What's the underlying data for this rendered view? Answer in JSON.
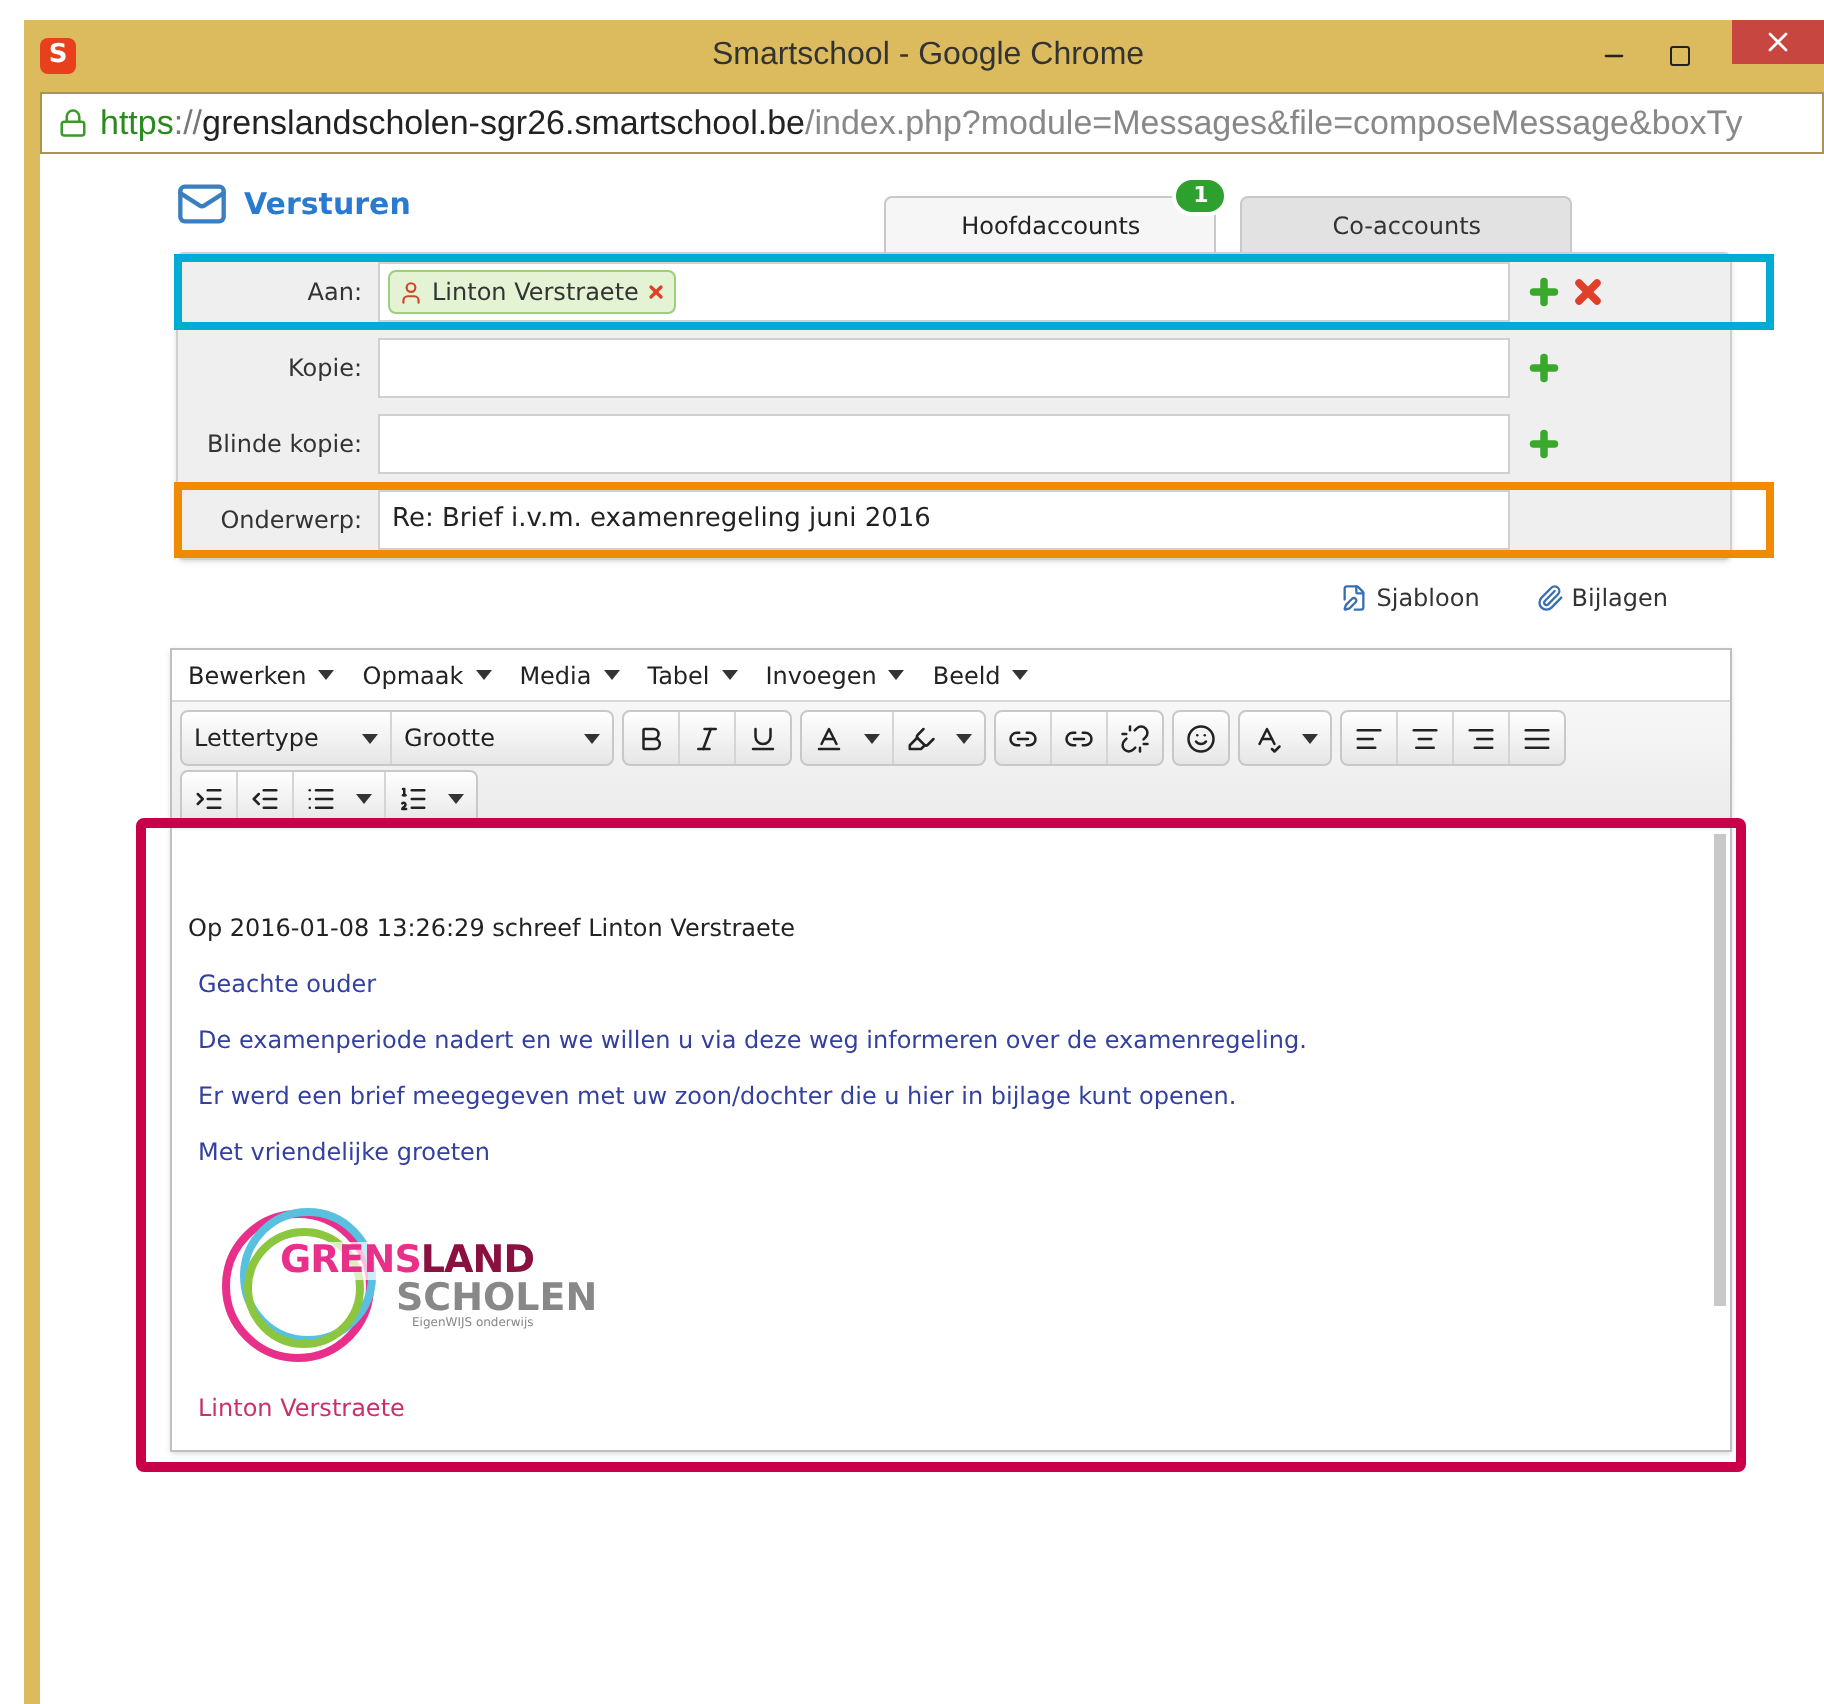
{
  "window": {
    "app_icon": "S",
    "title": "Smartschool - Google Chrome"
  },
  "address_bar": {
    "scheme": "https",
    "separator": "://",
    "host": "grenslandscholen-sgr26.smartschool.be",
    "path": "/index.php?module=Messages&file=composeMessage&boxTy"
  },
  "heading": "Versturen",
  "tabs": [
    {
      "label": "Hoofdaccounts",
      "selected": true,
      "badge": "1"
    },
    {
      "label": "Co-accounts",
      "selected": false
    }
  ],
  "fields": [
    {
      "label": "Aan:",
      "recipients": [
        "Linton Verstraete"
      ],
      "can_add": true,
      "can_clear": true,
      "highlight": {
        "color": "#00acd4"
      }
    },
    {
      "label": "Kopie:",
      "can_add": true
    },
    {
      "label": "Blinde kopie:",
      "can_add": true
    },
    {
      "label": "Onderwerp:",
      "value": "Re: Brief i.v.m. examenregeling juni 2016",
      "highlight": {
        "color": "#f08a00"
      }
    }
  ],
  "actions": [
    {
      "label": "Sjabloon",
      "kind": "template"
    },
    {
      "label": "Bijlagen",
      "kind": "attachment"
    }
  ],
  "editor": {
    "menus": [
      "Bewerken",
      "Opmaak",
      "Media",
      "Tabel",
      "Invoegen",
      "Beeld"
    ],
    "selects": [
      "Lettertype",
      "Grootte"
    ],
    "highlight": {
      "color": "#c8004a"
    },
    "quote_header": "Op 2016-01-08 13:26:29 schreef Linton Verstraete",
    "paragraphs": [
      "Geachte ouder",
      "De examenperiode nadert en we willen u via deze weg informeren over de examenregeling.",
      "Er werd een brief meegegeven met uw zoon/dochter die u hier in bijlage kunt openen.",
      "Met vriendelijke groeten"
    ],
    "logo": {
      "line_1a": "GRENS",
      "line_1b": "LAND",
      "line_2": "SCHOLEN",
      "tagline": "EigenWIJS onderwijs"
    },
    "signature": "Linton Verstraete"
  }
}
